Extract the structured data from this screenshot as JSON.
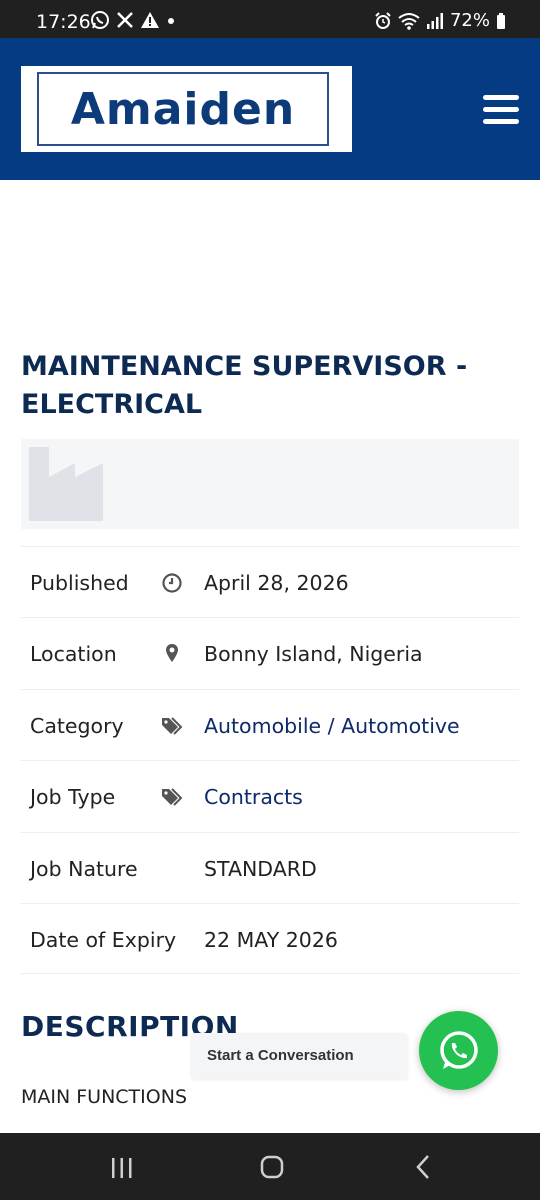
{
  "status_bar": {
    "time": "17:26",
    "battery": "72%",
    "left_icons": [
      "whatsapp-icon",
      "x-icon",
      "warning-icon",
      "dot-icon"
    ],
    "right_icons": [
      "alarm-icon",
      "wifi-icon",
      "signal-icon",
      "battery-icon"
    ]
  },
  "header": {
    "logo_text": "Amaiden",
    "menu_icon": "hamburger-menu-icon",
    "background": "#053b83"
  },
  "job": {
    "title": "MAINTENANCE SUPERVISOR - ELECTRICAL",
    "company_logo_icon": "factory-icon",
    "details": [
      {
        "label": "Published",
        "icon": "clock-icon",
        "value": "April 28, 2026"
      },
      {
        "label": "Location",
        "icon": "map-pin-icon",
        "value": "Bonny Island, Nigeria"
      },
      {
        "label": "Category",
        "icon": "tags-icon",
        "value": "Automobile / Automotive"
      },
      {
        "label": "Job Type",
        "icon": "tags-icon",
        "value": "Contracts"
      },
      {
        "label": "Job Nature",
        "icon": "",
        "value": "STANDARD"
      },
      {
        "label": "Date of Expiry",
        "icon": "",
        "value": "22 MAY 2026"
      }
    ]
  },
  "description": {
    "heading": "DESCRIPTION",
    "subheading": "MAIN FUNCTIONS"
  },
  "chat": {
    "label": "Start a Conversation",
    "icon": "whatsapp-icon",
    "color": "#24c152"
  },
  "nav_bar": {
    "icons": [
      "recent-apps-icon",
      "home-icon",
      "back-icon"
    ]
  }
}
